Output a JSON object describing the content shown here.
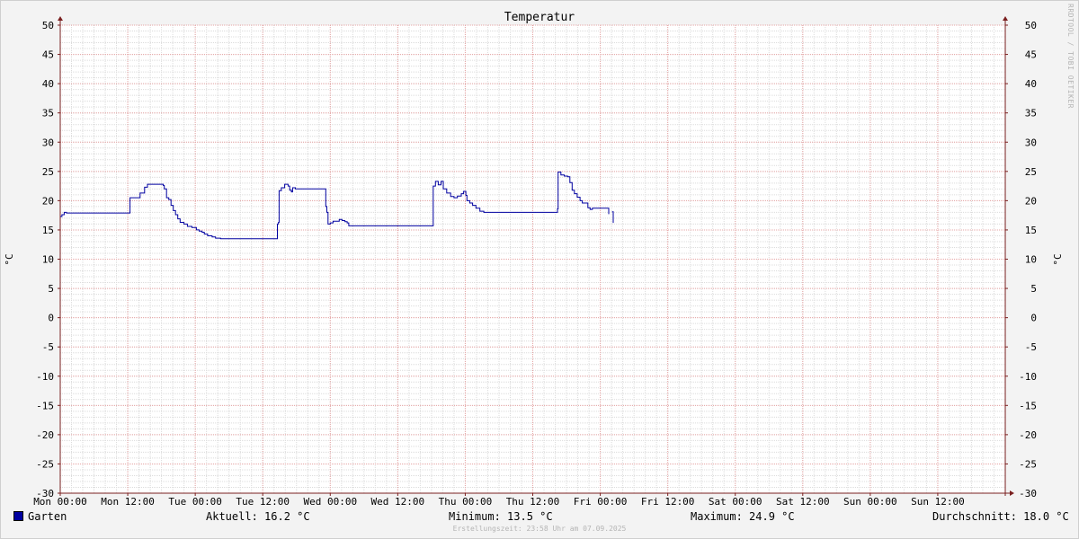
{
  "chart_data": {
    "type": "line",
    "title": "Temperatur",
    "ylabel": "°C",
    "ylabel_right": "°C",
    "ylim": [
      -30,
      50
    ],
    "y_ticks": [
      50,
      45,
      40,
      35,
      30,
      25,
      20,
      15,
      10,
      5,
      0,
      -5,
      -10,
      -15,
      -20,
      -25,
      -30
    ],
    "x_range_hours": [
      0,
      168
    ],
    "x_ticks": [
      {
        "h": 0,
        "label": "Mon 00:00"
      },
      {
        "h": 12,
        "label": "Mon 12:00"
      },
      {
        "h": 24,
        "label": "Tue 00:00"
      },
      {
        "h": 36,
        "label": "Tue 12:00"
      },
      {
        "h": 48,
        "label": "Wed 00:00"
      },
      {
        "h": 60,
        "label": "Wed 12:00"
      },
      {
        "h": 72,
        "label": "Thu 00:00"
      },
      {
        "h": 84,
        "label": "Thu 12:00"
      },
      {
        "h": 96,
        "label": "Fri 00:00"
      },
      {
        "h": 108,
        "label": "Fri 12:00"
      },
      {
        "h": 120,
        "label": "Sat 00:00"
      },
      {
        "h": 132,
        "label": "Sat 12:00"
      },
      {
        "h": 144,
        "label": "Sun 00:00"
      },
      {
        "h": 156,
        "label": "Sun 12:00"
      }
    ],
    "series": [
      {
        "name": "Garten",
        "color": "#0000a0",
        "points": [
          [
            0.0,
            17.3
          ],
          [
            0.3,
            17.6
          ],
          [
            0.7,
            18.0
          ],
          [
            1.1,
            17.9
          ],
          [
            2.0,
            17.9
          ],
          [
            5.0,
            17.9
          ],
          [
            8.0,
            17.9
          ],
          [
            11.0,
            17.9
          ],
          [
            12.2,
            17.9
          ],
          [
            12.4,
            20.5
          ],
          [
            13.5,
            20.5
          ],
          [
            14.2,
            21.3
          ],
          [
            14.5,
            21.3
          ],
          [
            15.0,
            22.3
          ],
          [
            15.5,
            22.8
          ],
          [
            17.5,
            22.8
          ],
          [
            18.3,
            22.6
          ],
          [
            18.5,
            22.0
          ],
          [
            18.9,
            20.5
          ],
          [
            19.3,
            20.2
          ],
          [
            19.7,
            19.2
          ],
          [
            20.1,
            18.3
          ],
          [
            20.5,
            17.6
          ],
          [
            20.9,
            16.9
          ],
          [
            21.3,
            16.3
          ],
          [
            22.0,
            16.0
          ],
          [
            22.6,
            15.6
          ],
          [
            23.4,
            15.4
          ],
          [
            23.8,
            15.4
          ],
          [
            24.2,
            15.0
          ],
          [
            24.7,
            14.8
          ],
          [
            25.2,
            14.6
          ],
          [
            25.6,
            14.3
          ],
          [
            26.2,
            14.0
          ],
          [
            27.0,
            13.8
          ],
          [
            27.6,
            13.6
          ],
          [
            28.5,
            13.5
          ],
          [
            30.0,
            13.5
          ],
          [
            33.0,
            13.5
          ],
          [
            35.0,
            13.5
          ],
          [
            38.4,
            13.5
          ],
          [
            38.6,
            16.0
          ],
          [
            38.8,
            16.3
          ],
          [
            38.9,
            21.7
          ],
          [
            39.3,
            22.2
          ],
          [
            39.9,
            22.8
          ],
          [
            40.5,
            22.5
          ],
          [
            40.8,
            21.8
          ],
          [
            41.1,
            21.5
          ],
          [
            41.3,
            22.2
          ],
          [
            41.8,
            22.0
          ],
          [
            44.0,
            22.0
          ],
          [
            46.5,
            22.0
          ],
          [
            47.0,
            22.0
          ],
          [
            47.2,
            19.0
          ],
          [
            47.4,
            18.0
          ],
          [
            47.6,
            16.0
          ],
          [
            48.0,
            16.2
          ],
          [
            48.5,
            16.5
          ],
          [
            49.2,
            16.5
          ],
          [
            49.6,
            16.8
          ],
          [
            50.1,
            16.6
          ],
          [
            50.6,
            16.4
          ],
          [
            51.0,
            16.2
          ],
          [
            51.3,
            15.7
          ],
          [
            54.0,
            15.7
          ],
          [
            58.0,
            15.7
          ],
          [
            62.0,
            15.7
          ],
          [
            65.0,
            15.7
          ],
          [
            66.1,
            15.7
          ],
          [
            66.3,
            22.5
          ],
          [
            66.7,
            23.3
          ],
          [
            67.2,
            22.7
          ],
          [
            67.7,
            23.3
          ],
          [
            68.1,
            22.0
          ],
          [
            68.7,
            21.3
          ],
          [
            69.4,
            20.7
          ],
          [
            70.0,
            20.5
          ],
          [
            70.6,
            20.8
          ],
          [
            71.3,
            21.2
          ],
          [
            71.7,
            21.6
          ],
          [
            72.1,
            20.9
          ],
          [
            72.3,
            20.0
          ],
          [
            72.8,
            19.6
          ],
          [
            73.3,
            19.2
          ],
          [
            73.9,
            18.7
          ],
          [
            74.6,
            18.2
          ],
          [
            75.3,
            18.0
          ],
          [
            78.0,
            18.0
          ],
          [
            82.0,
            18.0
          ],
          [
            86.0,
            18.0
          ],
          [
            88.2,
            18.0
          ],
          [
            88.4,
            18.6
          ],
          [
            88.5,
            24.9
          ],
          [
            89.0,
            24.4
          ],
          [
            89.6,
            24.2
          ],
          [
            90.2,
            24.1
          ],
          [
            90.6,
            23.1
          ],
          [
            91.0,
            21.8
          ],
          [
            91.4,
            21.2
          ],
          [
            91.9,
            20.6
          ],
          [
            92.4,
            20.0
          ],
          [
            92.8,
            19.6
          ],
          [
            93.5,
            19.6
          ],
          [
            93.8,
            18.8
          ],
          [
            94.2,
            18.5
          ],
          [
            94.6,
            18.7
          ],
          [
            97.4,
            18.7
          ],
          [
            97.5,
            17.7
          ]
        ]
      },
      {
        "name": "Garten",
        "color": "#0000a0",
        "points": [
          [
            98.1,
            18.1
          ],
          [
            98.3,
            16.2
          ]
        ]
      }
    ]
  },
  "legend": {
    "series_label": "Garten",
    "swatch_color": "#0000a0",
    "current": "Aktuell: 16.2 °C",
    "minimum": "Minimum: 13.5 °C",
    "maximum": "Maximum: 24.9 °C",
    "average": "Durchschnitt: 18.0 °C"
  },
  "footer": "Erstellungszeit: 23:58 Uhr am 07.09.2025",
  "watermark": "RRDTOOL / TOBI OETIKER",
  "colors": {
    "background": "#f3f3f3",
    "plot_background": "#ffffff",
    "minor_grid": "#dcdcdc",
    "major_grid": "#e6a5a5",
    "axis": "#7a1f1f",
    "line": "#0000a0"
  }
}
